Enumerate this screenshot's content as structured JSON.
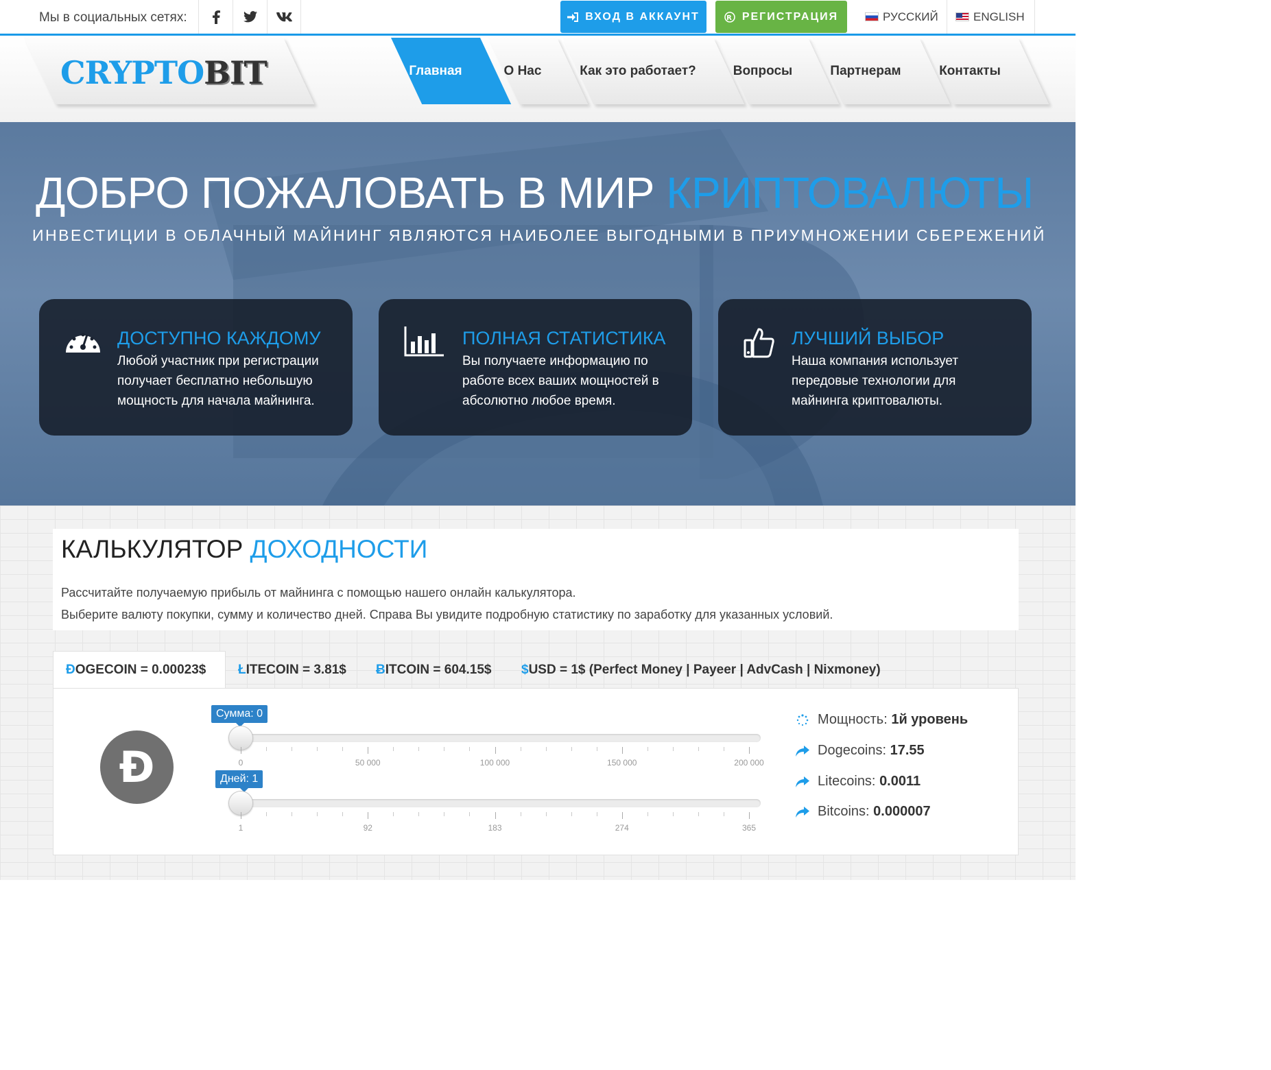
{
  "topbar": {
    "social_label": "Мы в социальных сетях:",
    "social": [
      {
        "icon": "facebook-icon"
      },
      {
        "icon": "twitter-icon"
      },
      {
        "icon": "vk-icon"
      }
    ],
    "login_label": "ВХОД В АККАУНТ",
    "register_label": "РЕГИСТРАЦИЯ",
    "languages": [
      {
        "label": "РУССКИЙ",
        "icon": "russia-flag-icon"
      },
      {
        "label": "ENGLISH",
        "icon": "usa-flag-icon"
      }
    ]
  },
  "header": {
    "logo": {
      "part1": "CRYPTO",
      "part2": "BIT"
    },
    "nav": [
      {
        "label": "Главная",
        "active": true
      },
      {
        "label": "О Нас"
      },
      {
        "label": "Как это работает?"
      },
      {
        "label": "Вопросы"
      },
      {
        "label": "Партнерам"
      },
      {
        "label": "Контакты"
      }
    ]
  },
  "hero": {
    "title_part1": "ДОБРО ПОЖАЛОВАТЬ В МИР ",
    "title_part2": "КРИПТОВАЛЮТЫ",
    "subtitle": "ИНВЕСТИЦИИ В ОБЛАЧНЫЙ МАЙНИНГ ЯВЛЯЮТСЯ НАИБОЛЕЕ ВЫГОДНЫМИ В ПРИУМНОЖЕНИИ СБЕРЕЖЕНИЙ",
    "features": [
      {
        "icon": "speedometer-icon",
        "title": "ДОСТУПНО КАЖДОМУ",
        "text": "Любой участник при регистрации получает бесплатно небольшую мощность для начала майнинга."
      },
      {
        "icon": "bar-chart-icon",
        "title": "ПОЛНАЯ СТАТИСТИКА",
        "text": "Вы получаете информацию по работе всех ваших мощностей в абсолютно любое время."
      },
      {
        "icon": "thumbs-up-icon",
        "title": "ЛУЧШИЙ ВЫБОР",
        "text": "Наша компания использует передовые технологии для майнинга криптовалюты."
      }
    ]
  },
  "calculator": {
    "title_part1": "КАЛЬКУЛЯТОР ",
    "title_part2": "ДОХОДНОСТИ",
    "description_line1": "Рассчитайте получаемую прибыль от майнинга с помощью нашего онлайн калькулятора.",
    "description_line2": "Выберите валюту покупки, сумму и количество дней. Справа Вы увидите подробную статистику по заработку для указанных условий.",
    "tabs": [
      {
        "symbol": "Ð",
        "label": "OGECOIN = 0.00023$",
        "active": true
      },
      {
        "symbol": "Ł",
        "label": "ITECOIN = 3.81$"
      },
      {
        "symbol": "Ƀ",
        "label": "ITCOIN = 604.15$"
      },
      {
        "symbol": "$",
        "label": "USD = 1$ (Perfect Money | Payeer | AdvCash | Nixmoney)"
      }
    ],
    "coin_icon": "dogecoin-icon",
    "coin_symbol": "Ð",
    "sliders": {
      "amount": {
        "label": "Сумма: 0",
        "value": 0,
        "min": 0,
        "max": 200000,
        "ticks": [
          "0",
          "50 000",
          "100 000",
          "150 000",
          "200 000"
        ]
      },
      "days": {
        "label": "Дней: 1",
        "value": 1,
        "min": 1,
        "max": 365,
        "ticks": [
          "1",
          "92",
          "183",
          "274",
          "365"
        ]
      }
    },
    "stats": [
      {
        "icon": "spinner-icon",
        "label": "Мощность: ",
        "value": "1й уровень"
      },
      {
        "icon": "share-arrow-icon",
        "label": "Dogecoins: ",
        "value": "17.55"
      },
      {
        "icon": "share-arrow-icon",
        "label": "Litecoins: ",
        "value": "0.0011"
      },
      {
        "icon": "share-arrow-icon",
        "label": "Bitcoins: ",
        "value": "0.000007"
      }
    ]
  }
}
